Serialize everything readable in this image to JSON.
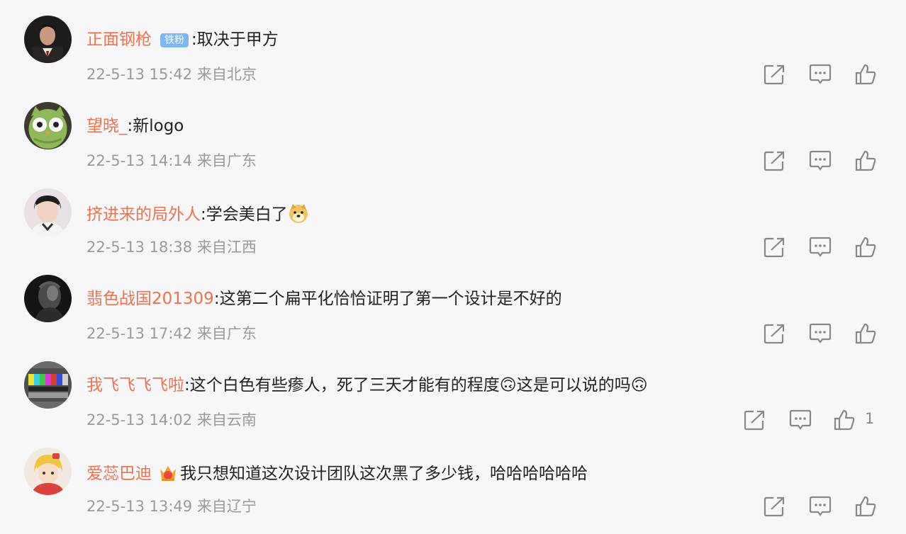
{
  "comments": [
    {
      "user": "正面钢枪",
      "badge": "铁粉",
      "separator": ":",
      "text": "取决于甲方",
      "date": "22-5-13 15:42",
      "location": "来自北京",
      "avatar": "avatar-suited-man"
    },
    {
      "user": "望晓_",
      "separator": ":",
      "text": "新logo",
      "date": "22-5-13 14:14",
      "location": "来自广东",
      "avatar": "avatar-green-owl"
    },
    {
      "user": "挤进来的局外人",
      "separator": ":",
      "text": "学会美白了",
      "emoji": "doge-emoji",
      "date": "22-5-13 18:38",
      "location": "来自江西",
      "avatar": "avatar-child-portrait"
    },
    {
      "user": "翡色战国201309",
      "separator": ":",
      "text": "这第二个扁平化恰恰证明了第一个设计是不好的",
      "date": "22-5-13 17:42",
      "location": "来自广东",
      "avatar": "avatar-dark-face"
    },
    {
      "user": "我飞飞飞飞啦",
      "separator": ":",
      "text": "这个白色有些瘆人，死了三天才能有的程度🙃这是可以说的吗🙃",
      "date": "22-5-13 14:02",
      "location": "来自云南",
      "like_count": "1",
      "avatar": "avatar-test-pattern"
    },
    {
      "user": "爱蕊巴迪",
      "separator": "",
      "crown_icon": "crown-badge-icon",
      "text": "我只想知道这次设计团队这次黑了多少钱，哈哈哈哈哈哈",
      "date": "22-5-13 13:49",
      "location": "来自辽宁",
      "avatar": "avatar-cartoon-girl"
    }
  ],
  "colors": {
    "background": "#f7f7f9",
    "username": "#eb7350",
    "badge": "#7eb7f0",
    "meta_text": "#9a9a9a",
    "icon": "#888888"
  },
  "icons": {
    "share": "share-icon",
    "comment": "comment-icon",
    "like": "like-icon"
  }
}
